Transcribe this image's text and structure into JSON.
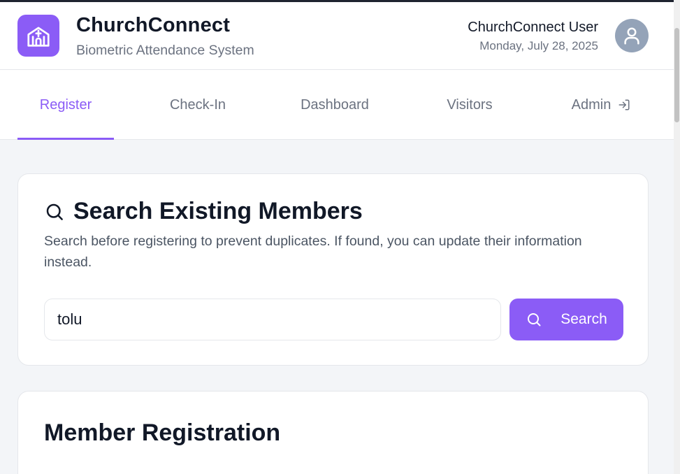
{
  "header": {
    "app_title": "ChurchConnect",
    "app_subtitle": "Biometric Attendance System",
    "logo_icon": "church-icon",
    "user_name": "ChurchConnect User",
    "date": "Monday, July 28, 2025",
    "avatar_icon": "user-icon"
  },
  "tabs": [
    {
      "label": "Register",
      "active": true
    },
    {
      "label": "Check-In",
      "active": false
    },
    {
      "label": "Dashboard",
      "active": false
    },
    {
      "label": "Visitors",
      "active": false
    },
    {
      "label": "Admin",
      "active": false,
      "icon": "login-icon"
    }
  ],
  "search_section": {
    "icon": "search-icon",
    "heading": "Search Existing Members",
    "description": "Search before registering to prevent duplicates. If found, you can update their information instead.",
    "input_value": "tolu",
    "button_label": "Search",
    "button_icon": "search-icon"
  },
  "registration_section": {
    "title": "Member Registration"
  },
  "colors": {
    "accent": "#8b5cf6",
    "text_primary": "#111827",
    "text_muted": "#6b7280",
    "background": "#f3f5f8",
    "avatar_bg": "#94a3b8"
  }
}
